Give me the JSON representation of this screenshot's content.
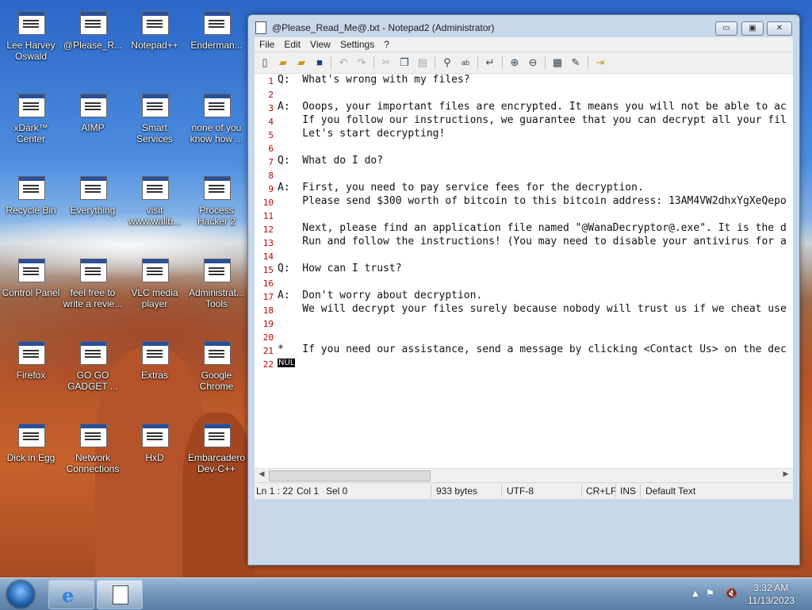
{
  "desktop": {
    "icons": [
      {
        "label": "Lee Harvey Oswald",
        "icon": "person-icon"
      },
      {
        "label": "@Please_R...",
        "icon": "text-document-icon"
      },
      {
        "label": "Notepad++",
        "icon": "notepad-plus-icon"
      },
      {
        "label": "Enderman...",
        "icon": "app-icon"
      },
      {
        "label": "xDark™ Center",
        "icon": "xdark-icon"
      },
      {
        "label": "AIMP",
        "icon": "aimp-icon"
      },
      {
        "label": "Smart Services",
        "icon": "services-icon"
      },
      {
        "label": "none of you know how ...",
        "icon": "app-icon"
      },
      {
        "label": "Recycle Bin",
        "icon": "recycle-bin-icon"
      },
      {
        "label": "Everything",
        "icon": "everything-icon"
      },
      {
        "label": "visit www.wallb...",
        "icon": "file-icon"
      },
      {
        "label": "Process Hacker 2",
        "icon": "process-hacker-icon"
      },
      {
        "label": "Control Panel",
        "icon": "control-panel-icon"
      },
      {
        "label": "feel free to write a revie...",
        "icon": "file-icon"
      },
      {
        "label": "VLC media player",
        "icon": "vlc-icon"
      },
      {
        "label": "Administrat... Tools",
        "icon": "admin-tools-icon"
      },
      {
        "label": "Firefox",
        "icon": "firefox-icon"
      },
      {
        "label": "GO GO GADGET ...",
        "icon": "app-icon"
      },
      {
        "label": "Extras",
        "icon": "extras-icon"
      },
      {
        "label": "Google Chrome",
        "icon": "chrome-icon"
      },
      {
        "label": "Dick in Egg",
        "icon": "app-icon"
      },
      {
        "label": "Network Connections",
        "icon": "network-icon"
      },
      {
        "label": "HxD",
        "icon": "hxd-icon"
      },
      {
        "label": "Embarcadero Dev-C++",
        "icon": "devcpp-icon"
      }
    ]
  },
  "window": {
    "title": "@Please_Read_Me@.txt - Notepad2 (Administrator)",
    "controls": {
      "minimize": "▭",
      "maximize": "▣",
      "close": "✕"
    },
    "menu": [
      "File",
      "Edit",
      "View",
      "Settings",
      "?"
    ],
    "editor": {
      "lines": [
        {
          "n": "1",
          "text": "Q:  What's wrong with my files?"
        },
        {
          "n": "2",
          "text": ""
        },
        {
          "n": "3",
          "text": "A:  Ooops, your important files are encrypted. It means you will not be able to ac"
        },
        {
          "n": "4",
          "text": "    If you follow our instructions, we guarantee that you can decrypt all your fil"
        },
        {
          "n": "5",
          "text": "    Let's start decrypting!"
        },
        {
          "n": "6",
          "text": ""
        },
        {
          "n": "7",
          "text": "Q:  What do I do?"
        },
        {
          "n": "8",
          "text": ""
        },
        {
          "n": "9",
          "text": "A:  First, you need to pay service fees for the decryption."
        },
        {
          "n": "10",
          "text": "    Please send $300 worth of bitcoin to this bitcoin address: 13AM4VW2dhxYgXeQepo"
        },
        {
          "n": "11",
          "text": ""
        },
        {
          "n": "12",
          "text": "    Next, please find an application file named \"@WanaDecryptor@.exe\". It is the d"
        },
        {
          "n": "13",
          "text": "    Run and follow the instructions! (You may need to disable your antivirus for a"
        },
        {
          "n": "14",
          "text": ""
        },
        {
          "n": "15",
          "text": "Q:  How can I trust?"
        },
        {
          "n": "16",
          "text": ""
        },
        {
          "n": "17",
          "text": "A:  Don't worry about decryption."
        },
        {
          "n": "18",
          "text": "    We will decrypt your files surely because nobody will trust us if we cheat use"
        },
        {
          "n": "19",
          "text": ""
        },
        {
          "n": "20",
          "text": ""
        },
        {
          "n": "21",
          "text": "*   If you need our assistance, send a message by clicking <Contact Us> on the dec"
        },
        {
          "n": "22",
          "text": ""
        }
      ],
      "nul_marker": "NUL"
    },
    "status": {
      "position": "Ln 1 : 22",
      "column": "Col 1",
      "selection": "Sel 0",
      "size": "933 bytes",
      "encoding": "UTF-8",
      "line_endings": "CR+LF",
      "mode": "INS",
      "scheme": "Default Text"
    }
  },
  "taskbar": {
    "time": "3:32 AM",
    "date": "11/13/2023"
  }
}
